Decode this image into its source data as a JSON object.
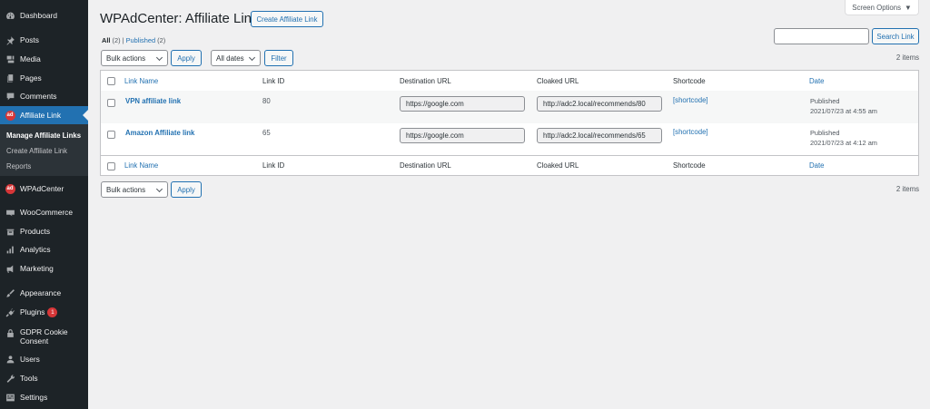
{
  "sidebar": {
    "items": [
      {
        "label": "Dashboard",
        "icon": "dashboard-icon"
      },
      {
        "label": "Posts",
        "icon": "pin-icon"
      },
      {
        "label": "Media",
        "icon": "media-icon"
      },
      {
        "label": "Pages",
        "icon": "pages-icon"
      },
      {
        "label": "Comments",
        "icon": "comment-icon"
      },
      {
        "label": "Affiliate Link",
        "icon": "wpadcenter-icon"
      },
      {
        "label": "WPAdCenter",
        "icon": "wpadcenter-icon"
      },
      {
        "label": "WooCommerce",
        "icon": "woocommerce-icon"
      },
      {
        "label": "Products",
        "icon": "products-icon"
      },
      {
        "label": "Analytics",
        "icon": "analytics-icon"
      },
      {
        "label": "Marketing",
        "icon": "megaphone-icon"
      },
      {
        "label": "Appearance",
        "icon": "brush-icon"
      },
      {
        "label": "Plugins",
        "icon": "plugin-icon",
        "badge": "1"
      },
      {
        "label": "GDPR Cookie Consent",
        "label_line1": "GDPR Cookie",
        "label_line2": "Consent",
        "icon": "lock-icon"
      },
      {
        "label": "Users",
        "icon": "users-icon"
      },
      {
        "label": "Tools",
        "icon": "wrench-icon"
      },
      {
        "label": "Settings",
        "icon": "settings-icon"
      }
    ],
    "submenu": [
      {
        "label": "Manage Affiliate Links"
      },
      {
        "label": "Create Affiliate Link"
      },
      {
        "label": "Reports"
      }
    ],
    "active_color": "#2271b1",
    "background": "#1d2327"
  },
  "header": {
    "title": "WPAdCenter: Affiliate Link",
    "create_button": "Create Affiliate Link",
    "screen_options": "Screen Options"
  },
  "filters": {
    "all_label": "All",
    "all_count": "(2)",
    "separator": "|",
    "published_label": "Published",
    "published_count": "(2)",
    "bulk_actions": "Bulk actions",
    "apply": "Apply",
    "all_dates": "All dates",
    "filter": "Filter",
    "search_button": "Search Link",
    "search_value": "",
    "items_count": "2 items"
  },
  "table": {
    "columns": [
      "Link Name",
      "Link ID",
      "Destination URL",
      "Cloaked URL",
      "Shortcode",
      "Date"
    ],
    "rows": [
      {
        "name": "VPN affiliate link",
        "id": "80",
        "destination": "https://google.com",
        "cloaked": "http://adc2.local/recommends/80",
        "shortcode": "[shortcode]",
        "status": "Published",
        "date": "2021/07/23 at 4:55 am"
      },
      {
        "name": "Amazon Affiliate link",
        "id": "65",
        "destination": "https://google.com",
        "cloaked": "http://adc2.local/recommends/65",
        "shortcode": "[shortcode]",
        "status": "Published",
        "date": "2021/07/23 at 4:12 am"
      }
    ]
  },
  "bottom": {
    "bulk_actions": "Bulk actions",
    "apply": "Apply",
    "items_count": "2 items"
  }
}
